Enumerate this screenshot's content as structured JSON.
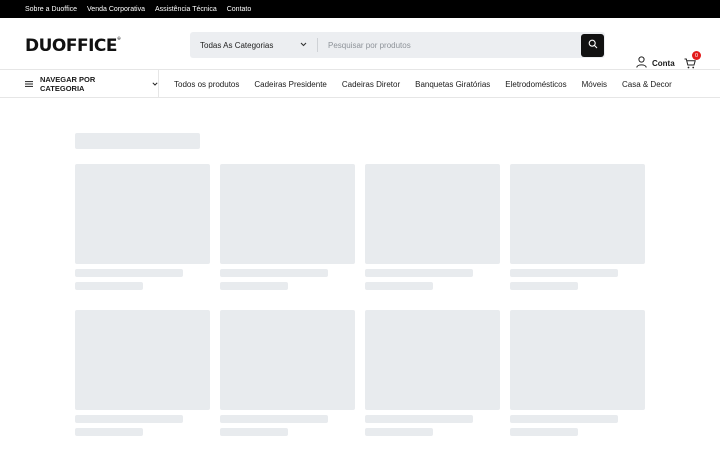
{
  "topbar": {
    "links": [
      "Sobre a Duoffice",
      "Venda Corporativa",
      "Assistência Técnica",
      "Contato"
    ]
  },
  "header": {
    "logo": "DUOFFICE",
    "logo_mark": "®",
    "category_select": "Todas As Categorias",
    "search_placeholder": "Pesquisar por produtos",
    "account_label": "Conta",
    "cart_count": "0"
  },
  "nav": {
    "browse_label": "NAVEGAR POR CATEGORIA",
    "links": [
      "Todos os produtos",
      "Cadeiras Presidente",
      "Cadeiras Diretor",
      "Banquetas Giratórias",
      "Eletrodomésticos",
      "Móveis",
      "Casa & Decor"
    ]
  },
  "colors": {
    "topbar": "#000000",
    "skeleton": "#e8ebee",
    "search_bg": "#eceef1",
    "badge": "#e31b1b"
  }
}
